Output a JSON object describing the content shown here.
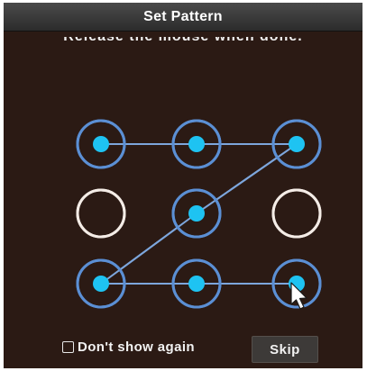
{
  "dialog": {
    "title": "Set Pattern",
    "instruction": "Release the mouse when done."
  },
  "pattern": {
    "grid_size": 3,
    "node_states": [
      [
        "selected",
        "selected",
        "selected"
      ],
      [
        "unselected",
        "selected",
        "unselected"
      ],
      [
        "selected",
        "selected",
        "selected"
      ]
    ],
    "sequence": [
      [
        0,
        0
      ],
      [
        0,
        1
      ],
      [
        0,
        2
      ],
      [
        1,
        1
      ],
      [
        2,
        0
      ],
      [
        2,
        1
      ],
      [
        2,
        2
      ]
    ],
    "colors": {
      "background": "#2b1a14",
      "selected_ring": "#5b8fd4",
      "selected_dot": "#1ec3f2",
      "unselected_ring": "#f4ece6",
      "line": "#7da6dc"
    }
  },
  "footer": {
    "checkbox_label": "Don't show again",
    "checkbox_checked": false,
    "skip_label": "Skip"
  },
  "cursor": {
    "icon": "arrow-cursor-icon"
  }
}
